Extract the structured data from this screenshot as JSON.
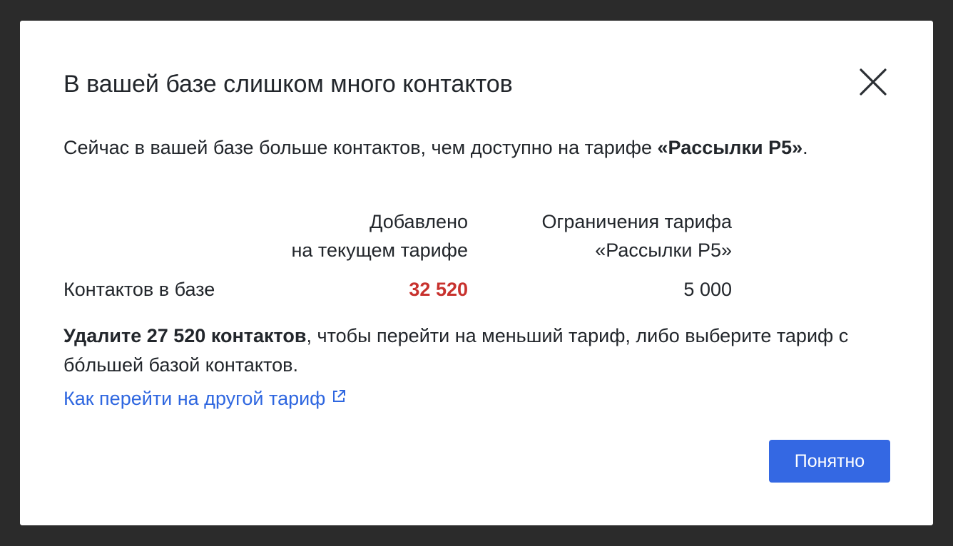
{
  "modal": {
    "title": "В вашей базе слишком много контактов",
    "close_icon": "close-icon",
    "intro_text": "Сейчас в вашей базе больше контактов, чем доступно на тарифе ",
    "intro_plan": "«Рассылки P5»",
    "intro_suffix": ".",
    "table": {
      "col_added_line1": "Добавлено",
      "col_added_line2": "на текущем тарифе",
      "col_limit_line1": "Ограничения тарифа",
      "col_limit_line2": "«Рассылки P5»",
      "row_label": "Контактов в базе",
      "row_added_value": "32 520",
      "row_limit_value": "5 000"
    },
    "advice_bold": "Удалите 27 520 контактов",
    "advice_text": ", чтобы перейти на меньший тариф, либо выберите тариф с бóльшей базой контактов.",
    "help_link": "Как перейти на другой тариф",
    "help_link_icon": "external-link-icon",
    "ok_button": "Понятно"
  },
  "colors": {
    "overlay": "#2b2b2b",
    "accent": "#3468e3",
    "link": "#2f67e0",
    "warning_value": "#c8322e"
  }
}
